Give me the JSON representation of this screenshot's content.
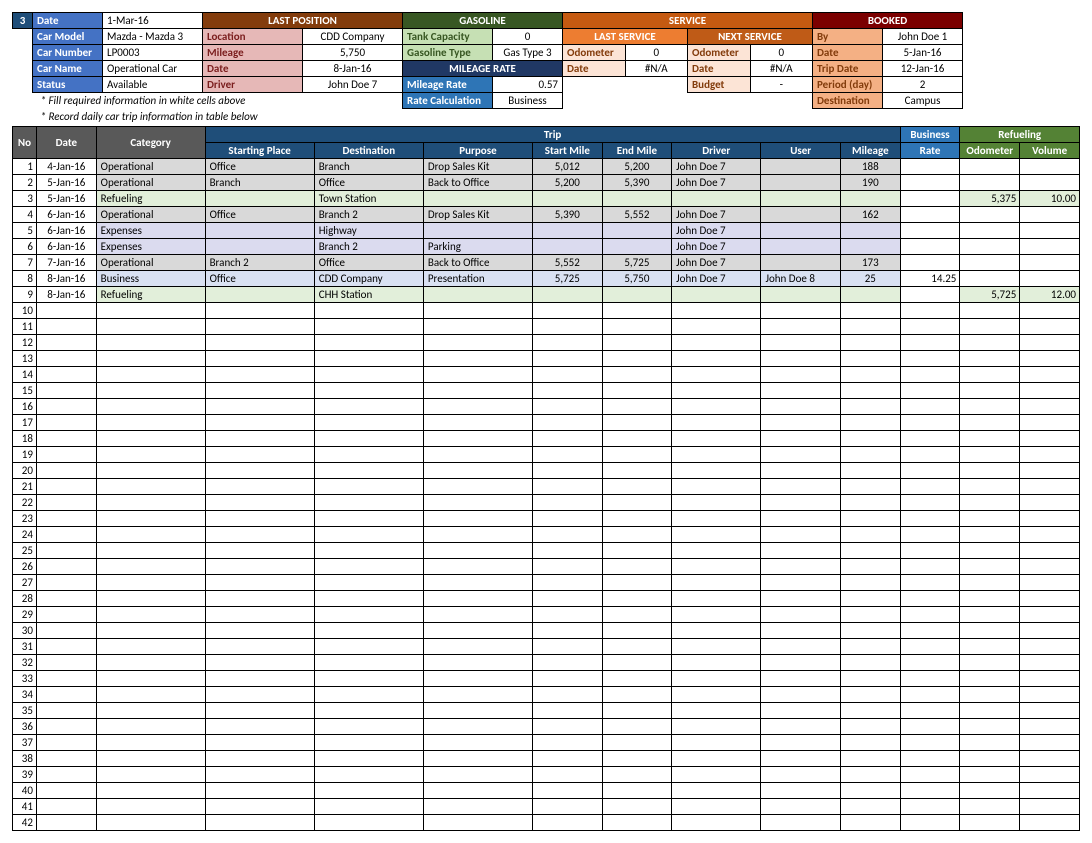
{
  "top_number": "3",
  "car": {
    "date_lbl": "Date",
    "date": "1-Mar-16",
    "model_lbl": "Car Model",
    "model": "Mazda - Mazda 3",
    "number_lbl": "Car Number",
    "number": "LP0003",
    "name_lbl": "Car Name",
    "name": "Operational Car",
    "status_lbl": "Status",
    "status": "Available"
  },
  "last_position": {
    "title": "LAST POSITION",
    "location_lbl": "Location",
    "location": "CDD Company",
    "mileage_lbl": "Mileage",
    "mileage": "5,750",
    "date_lbl": "Date",
    "date": "8-Jan-16",
    "driver_lbl": "Driver",
    "driver": "John Doe 7"
  },
  "gasoline": {
    "title": "GASOLINE",
    "tank_lbl": "Tank Capacity",
    "tank": "0",
    "type_lbl": "Gasoline Type",
    "type": "Gas Type 3",
    "mileage_rate_title": "MILEAGE RATE",
    "rate_lbl": "Mileage Rate",
    "rate": "0.57",
    "calc_lbl": "Rate Calculation",
    "calc": "Business"
  },
  "service": {
    "title": "SERVICE",
    "last_title": "LAST SERVICE",
    "next_title": "NEXT SERVICE",
    "odometer_lbl": "Odometer",
    "last_odometer": "0",
    "next_odometer": "0",
    "date_lbl": "Date",
    "last_date": "#N/A",
    "next_date": "#N/A",
    "budget_lbl": "Budget",
    "budget": "-"
  },
  "booked": {
    "title": "BOOKED",
    "by_lbl": "By",
    "by": "John Doe 1",
    "date_lbl": "Date",
    "date": "5-Jan-16",
    "trip_lbl": "Trip Date",
    "trip": "12-Jan-16",
    "period_lbl": "Period (day)",
    "period": "2",
    "dest_lbl": "Destination",
    "dest": "Campus"
  },
  "notes": [
    "* Fill required information in white cells above",
    "* Record daily car trip information in table below"
  ],
  "log_headers": {
    "no": "No",
    "date": "Date",
    "category": "Category",
    "trip": "Trip",
    "start_place": "Starting Place",
    "destination": "Destination",
    "purpose": "Purpose",
    "start_mile": "Start Mile",
    "end_mile": "End Mile",
    "driver": "Driver",
    "user": "User",
    "mileage": "Mileage",
    "business": "Business",
    "rate": "Rate",
    "refueling": "Refueling",
    "odometer": "Odometer",
    "volume": "Volume"
  },
  "log_rows": [
    {
      "no": "1",
      "date": "4-Jan-16",
      "cat": "Operational",
      "catc": "c-gray",
      "sp": "Office",
      "dest": "Branch",
      "purpose": "Drop Sales Kit",
      "sm": "5,012",
      "em": "5,200",
      "driver": "John Doe 7",
      "user": "",
      "mileage": "188",
      "rate": "",
      "odo": "",
      "vol": ""
    },
    {
      "no": "2",
      "date": "5-Jan-16",
      "cat": "Operational",
      "catc": "c-gray",
      "sp": "Branch",
      "dest": "Office",
      "purpose": "Back to Office",
      "sm": "5,200",
      "em": "5,390",
      "driver": "John Doe 7",
      "user": "",
      "mileage": "190",
      "rate": "",
      "odo": "",
      "vol": ""
    },
    {
      "no": "3",
      "date": "5-Jan-16",
      "cat": "Refueling",
      "catc": "c-lgreen",
      "sp": "",
      "dest": "Town Station",
      "purpose": "",
      "sm": "",
      "em": "",
      "driver": "",
      "user": "",
      "mileage": "",
      "rate": "",
      "odo": "5,375",
      "vol": "10.00"
    },
    {
      "no": "4",
      "date": "6-Jan-16",
      "cat": "Operational",
      "catc": "c-gray",
      "sp": "Office",
      "dest": "Branch 2",
      "purpose": "Drop Sales Kit",
      "sm": "5,390",
      "em": "5,552",
      "driver": "John Doe 7",
      "user": "",
      "mileage": "162",
      "rate": "",
      "odo": "",
      "vol": ""
    },
    {
      "no": "5",
      "date": "6-Jan-16",
      "cat": "Expenses",
      "catc": "c-lav",
      "sp": "",
      "dest": "Highway",
      "purpose": "",
      "sm": "",
      "em": "",
      "driver": "John Doe 7",
      "user": "",
      "mileage": "",
      "rate": "",
      "odo": "",
      "vol": ""
    },
    {
      "no": "6",
      "date": "6-Jan-16",
      "cat": "Expenses",
      "catc": "c-lav",
      "sp": "",
      "dest": "Branch 2",
      "purpose": "Parking",
      "sm": "",
      "em": "",
      "driver": "John Doe 7",
      "user": "",
      "mileage": "",
      "rate": "",
      "odo": "",
      "vol": ""
    },
    {
      "no": "7",
      "date": "7-Jan-16",
      "cat": "Operational",
      "catc": "c-gray",
      "sp": "Branch 2",
      "dest": "Office",
      "purpose": "Back to Office",
      "sm": "5,552",
      "em": "5,725",
      "driver": "John Doe 7",
      "user": "",
      "mileage": "173",
      "rate": "",
      "odo": "",
      "vol": ""
    },
    {
      "no": "8",
      "date": "8-Jan-16",
      "cat": "Business",
      "catc": "c-lblue",
      "sp": "Office",
      "dest": "CDD Company",
      "purpose": "Presentation",
      "sm": "5,725",
      "em": "5,750",
      "driver": "John Doe 7",
      "user": "John Doe 8",
      "mileage": "25",
      "rate": "14.25",
      "odo": "",
      "vol": ""
    },
    {
      "no": "9",
      "date": "8-Jan-16",
      "cat": "Refueling",
      "catc": "c-lgreen",
      "sp": "",
      "dest": "CHH Station",
      "purpose": "",
      "sm": "",
      "em": "",
      "driver": "",
      "user": "",
      "mileage": "",
      "rate": "",
      "odo": "5,725",
      "vol": "12.00"
    }
  ],
  "empty_row_count": 33
}
